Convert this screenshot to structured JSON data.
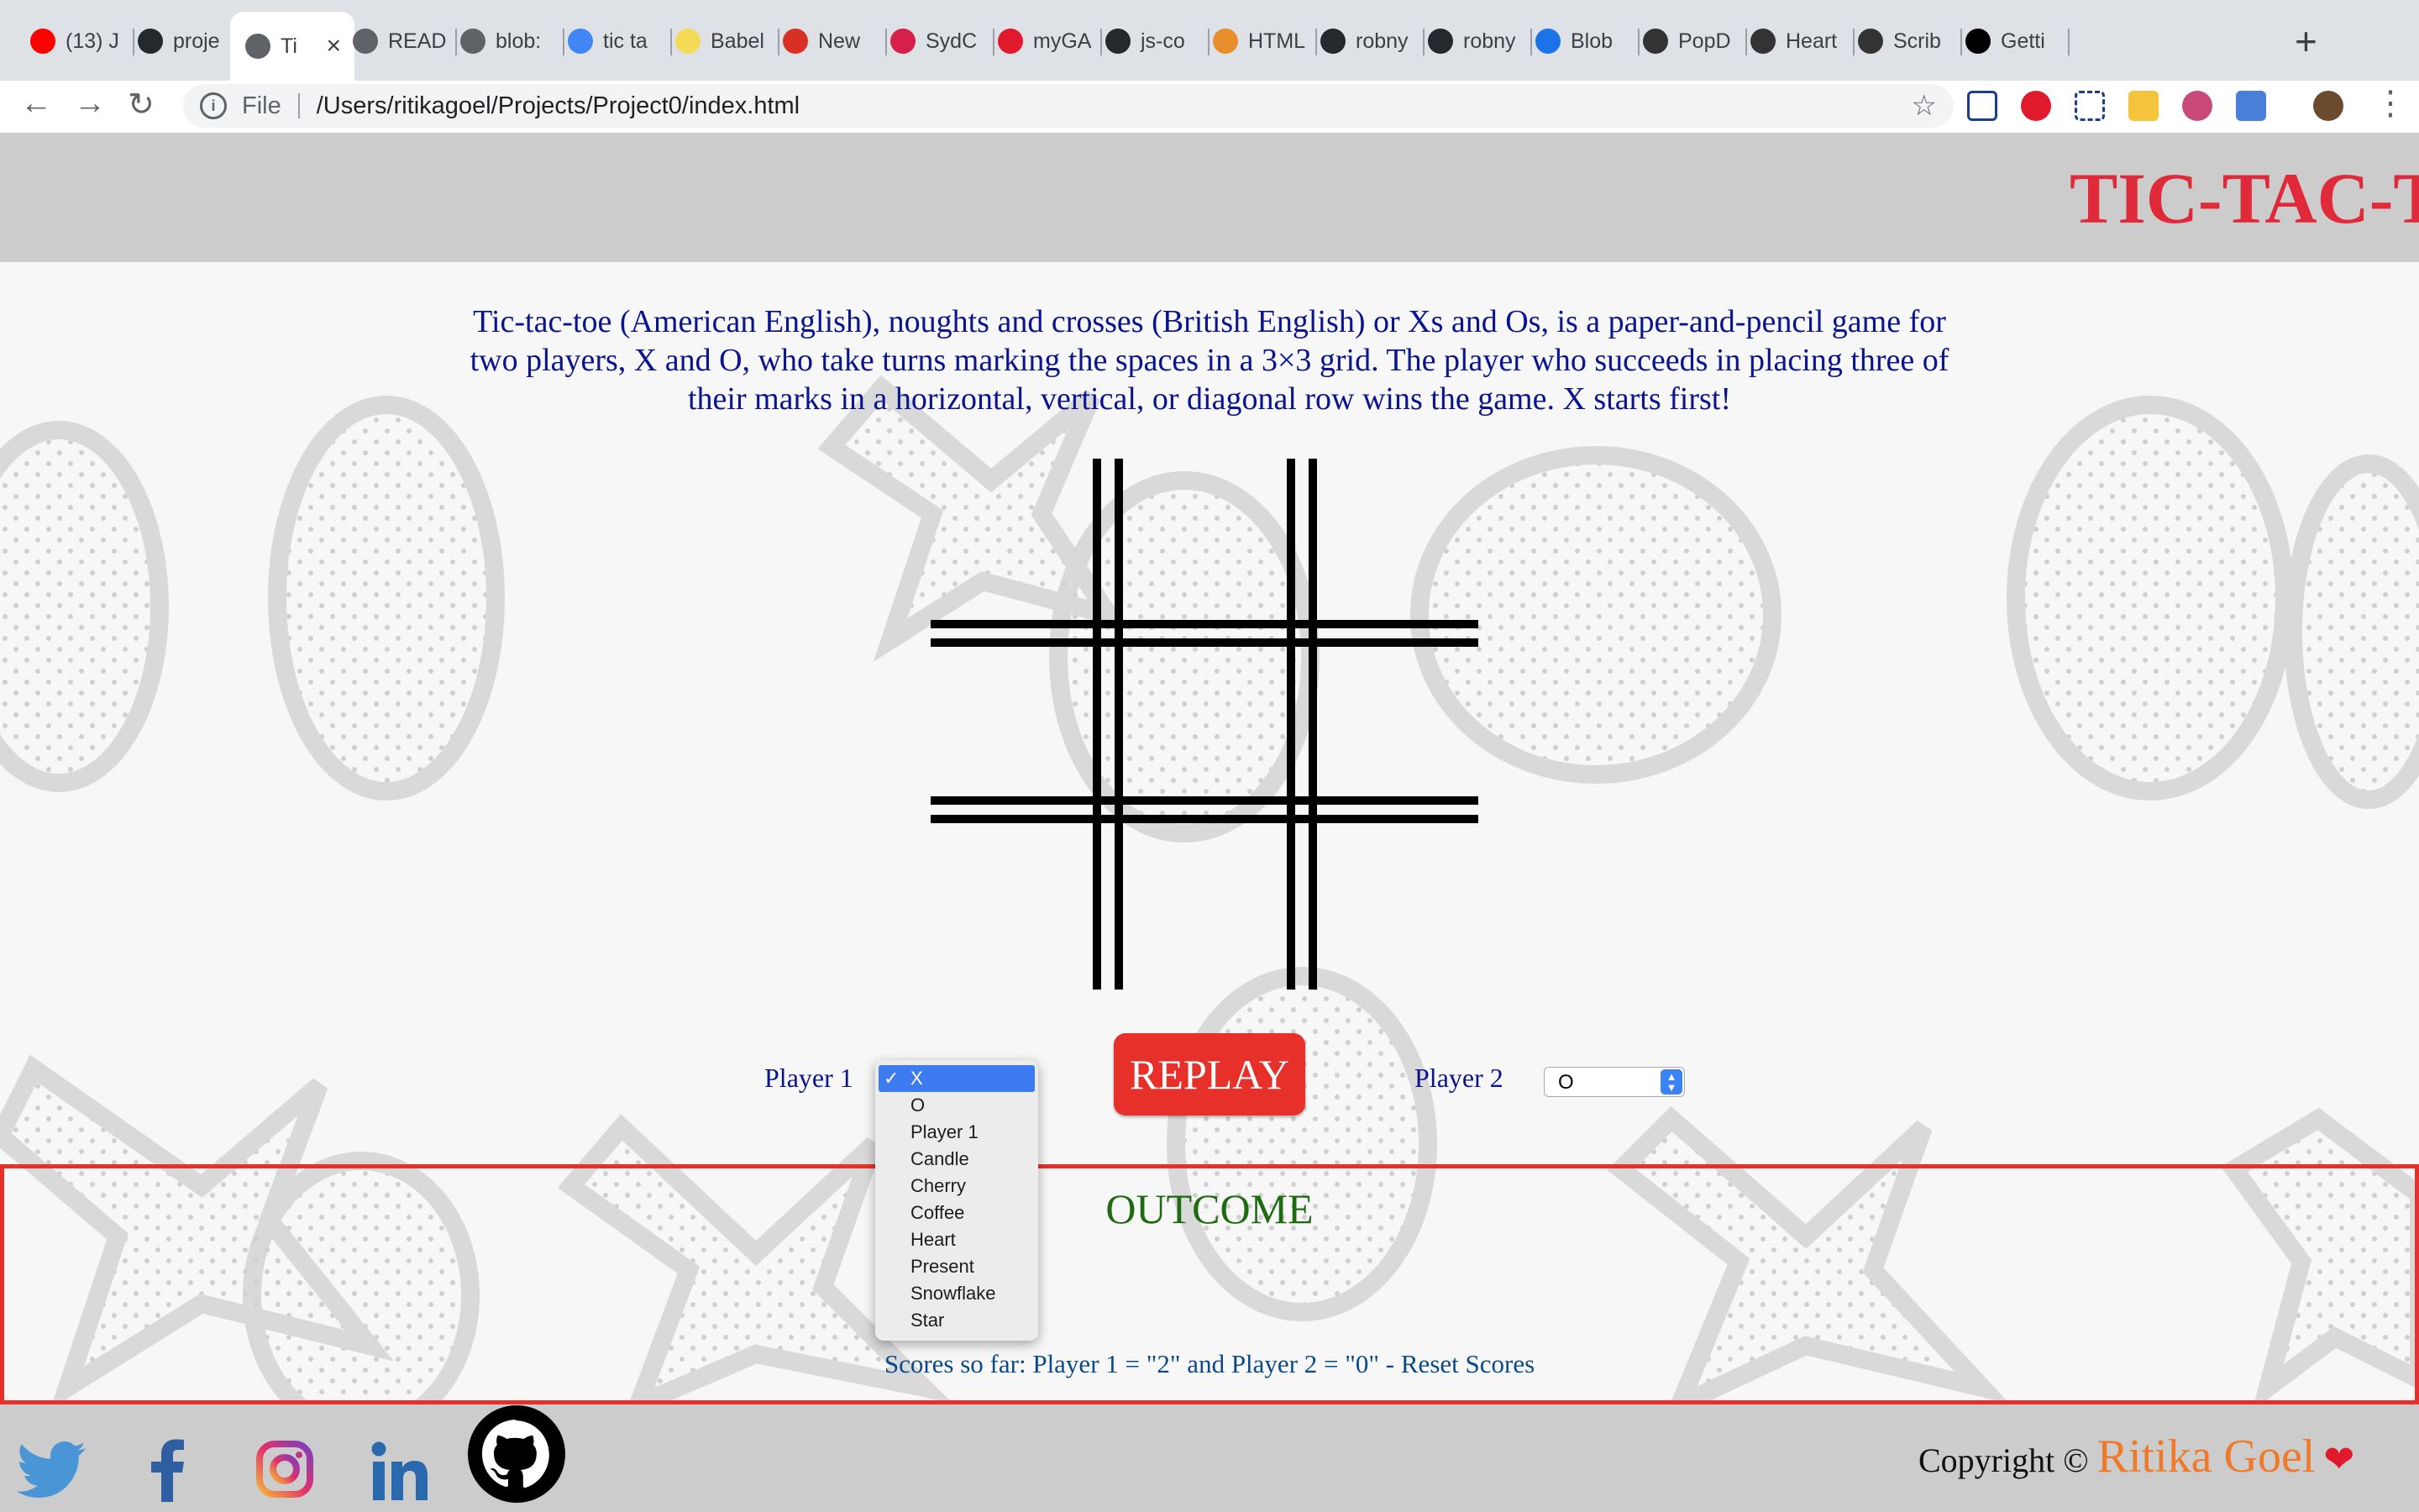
{
  "browser": {
    "tabs": [
      {
        "label": "(13) J",
        "icon": "youtube-icon",
        "color": "#ff0000"
      },
      {
        "label": "proje",
        "icon": "github-icon",
        "color": "#24292e"
      },
      {
        "label": "Ti",
        "icon": "file-icon",
        "color": "#5f6368",
        "active": true
      },
      {
        "label": "READ",
        "icon": "file-icon",
        "color": "#5f6368"
      },
      {
        "label": "blob:",
        "icon": "file-icon",
        "color": "#5f6368"
      },
      {
        "label": "tic ta",
        "icon": "google-icon",
        "color": "#4285f4"
      },
      {
        "label": "Babel",
        "icon": "babel-icon",
        "color": "#f5da55"
      },
      {
        "label": "New",
        "icon": "gmail-icon",
        "color": "#d93025"
      },
      {
        "label": "SydC",
        "icon": "meetup-icon",
        "color": "#d6204b"
      },
      {
        "label": "myGA",
        "icon": "ga-icon",
        "color": "#e0192c"
      },
      {
        "label": "js-co",
        "icon": "github-icon",
        "color": "#24292e"
      },
      {
        "label": "HTML",
        "icon": "html-icon",
        "color": "#e88e2c"
      },
      {
        "label": "robny",
        "icon": "github-icon",
        "color": "#24292e"
      },
      {
        "label": "robny",
        "icon": "github-icon",
        "color": "#24292e"
      },
      {
        "label": "Blob",
        "icon": "blob-icon",
        "color": "#1a73e8"
      },
      {
        "label": "PopD",
        "icon": "popd-icon",
        "color": "#333333"
      },
      {
        "label": "Heart",
        "icon": "scribe-icon",
        "color": "#333333"
      },
      {
        "label": "Scrib",
        "icon": "scribe-icon",
        "color": "#333333"
      },
      {
        "label": "Getti",
        "icon": "medium-icon",
        "color": "#000000"
      }
    ],
    "omnibox": {
      "scheme": "File",
      "url": "/Users/ritikagoel/Projects/Project0/index.html"
    }
  },
  "page": {
    "title": "TIC-TAC-TOE",
    "intro": "Tic-tac-toe (American English), noughts and crosses (British English) or Xs and Os, is a paper-and-pencil game for two players, X and O, who take turns marking the spaces in a 3×3 grid. The player who succeeds in placing three of their marks in a horizontal, vertical, or diagonal row wins the game. X starts first!",
    "player1_label": "Player 1",
    "player2_label": "Player 2",
    "replay_label": "REPLAY",
    "player1_options": [
      "X",
      "O",
      "Player 1",
      "Candle",
      "Cherry",
      "Coffee",
      "Heart",
      "Present",
      "Snowflake",
      "Star"
    ],
    "player1_selected": "X",
    "player2_selected": "O",
    "outcome_title": "OUTCOME",
    "scores_text": "Scores so far: Player 1 = \"2\" and Player 2 = \"0\" - Reset Scores"
  },
  "footer": {
    "copyright": "Copyright ©",
    "author": "Ritika Goel",
    "heart": "❤",
    "social": [
      "twitter-icon",
      "facebook-icon",
      "instagram-icon",
      "linkedin-icon",
      "github-icon"
    ]
  },
  "colors": {
    "title": "#e02a3a",
    "text": "#0a1390",
    "replay": "#e8302a",
    "outcome": "#1f6b12",
    "header": "#cccccc"
  }
}
